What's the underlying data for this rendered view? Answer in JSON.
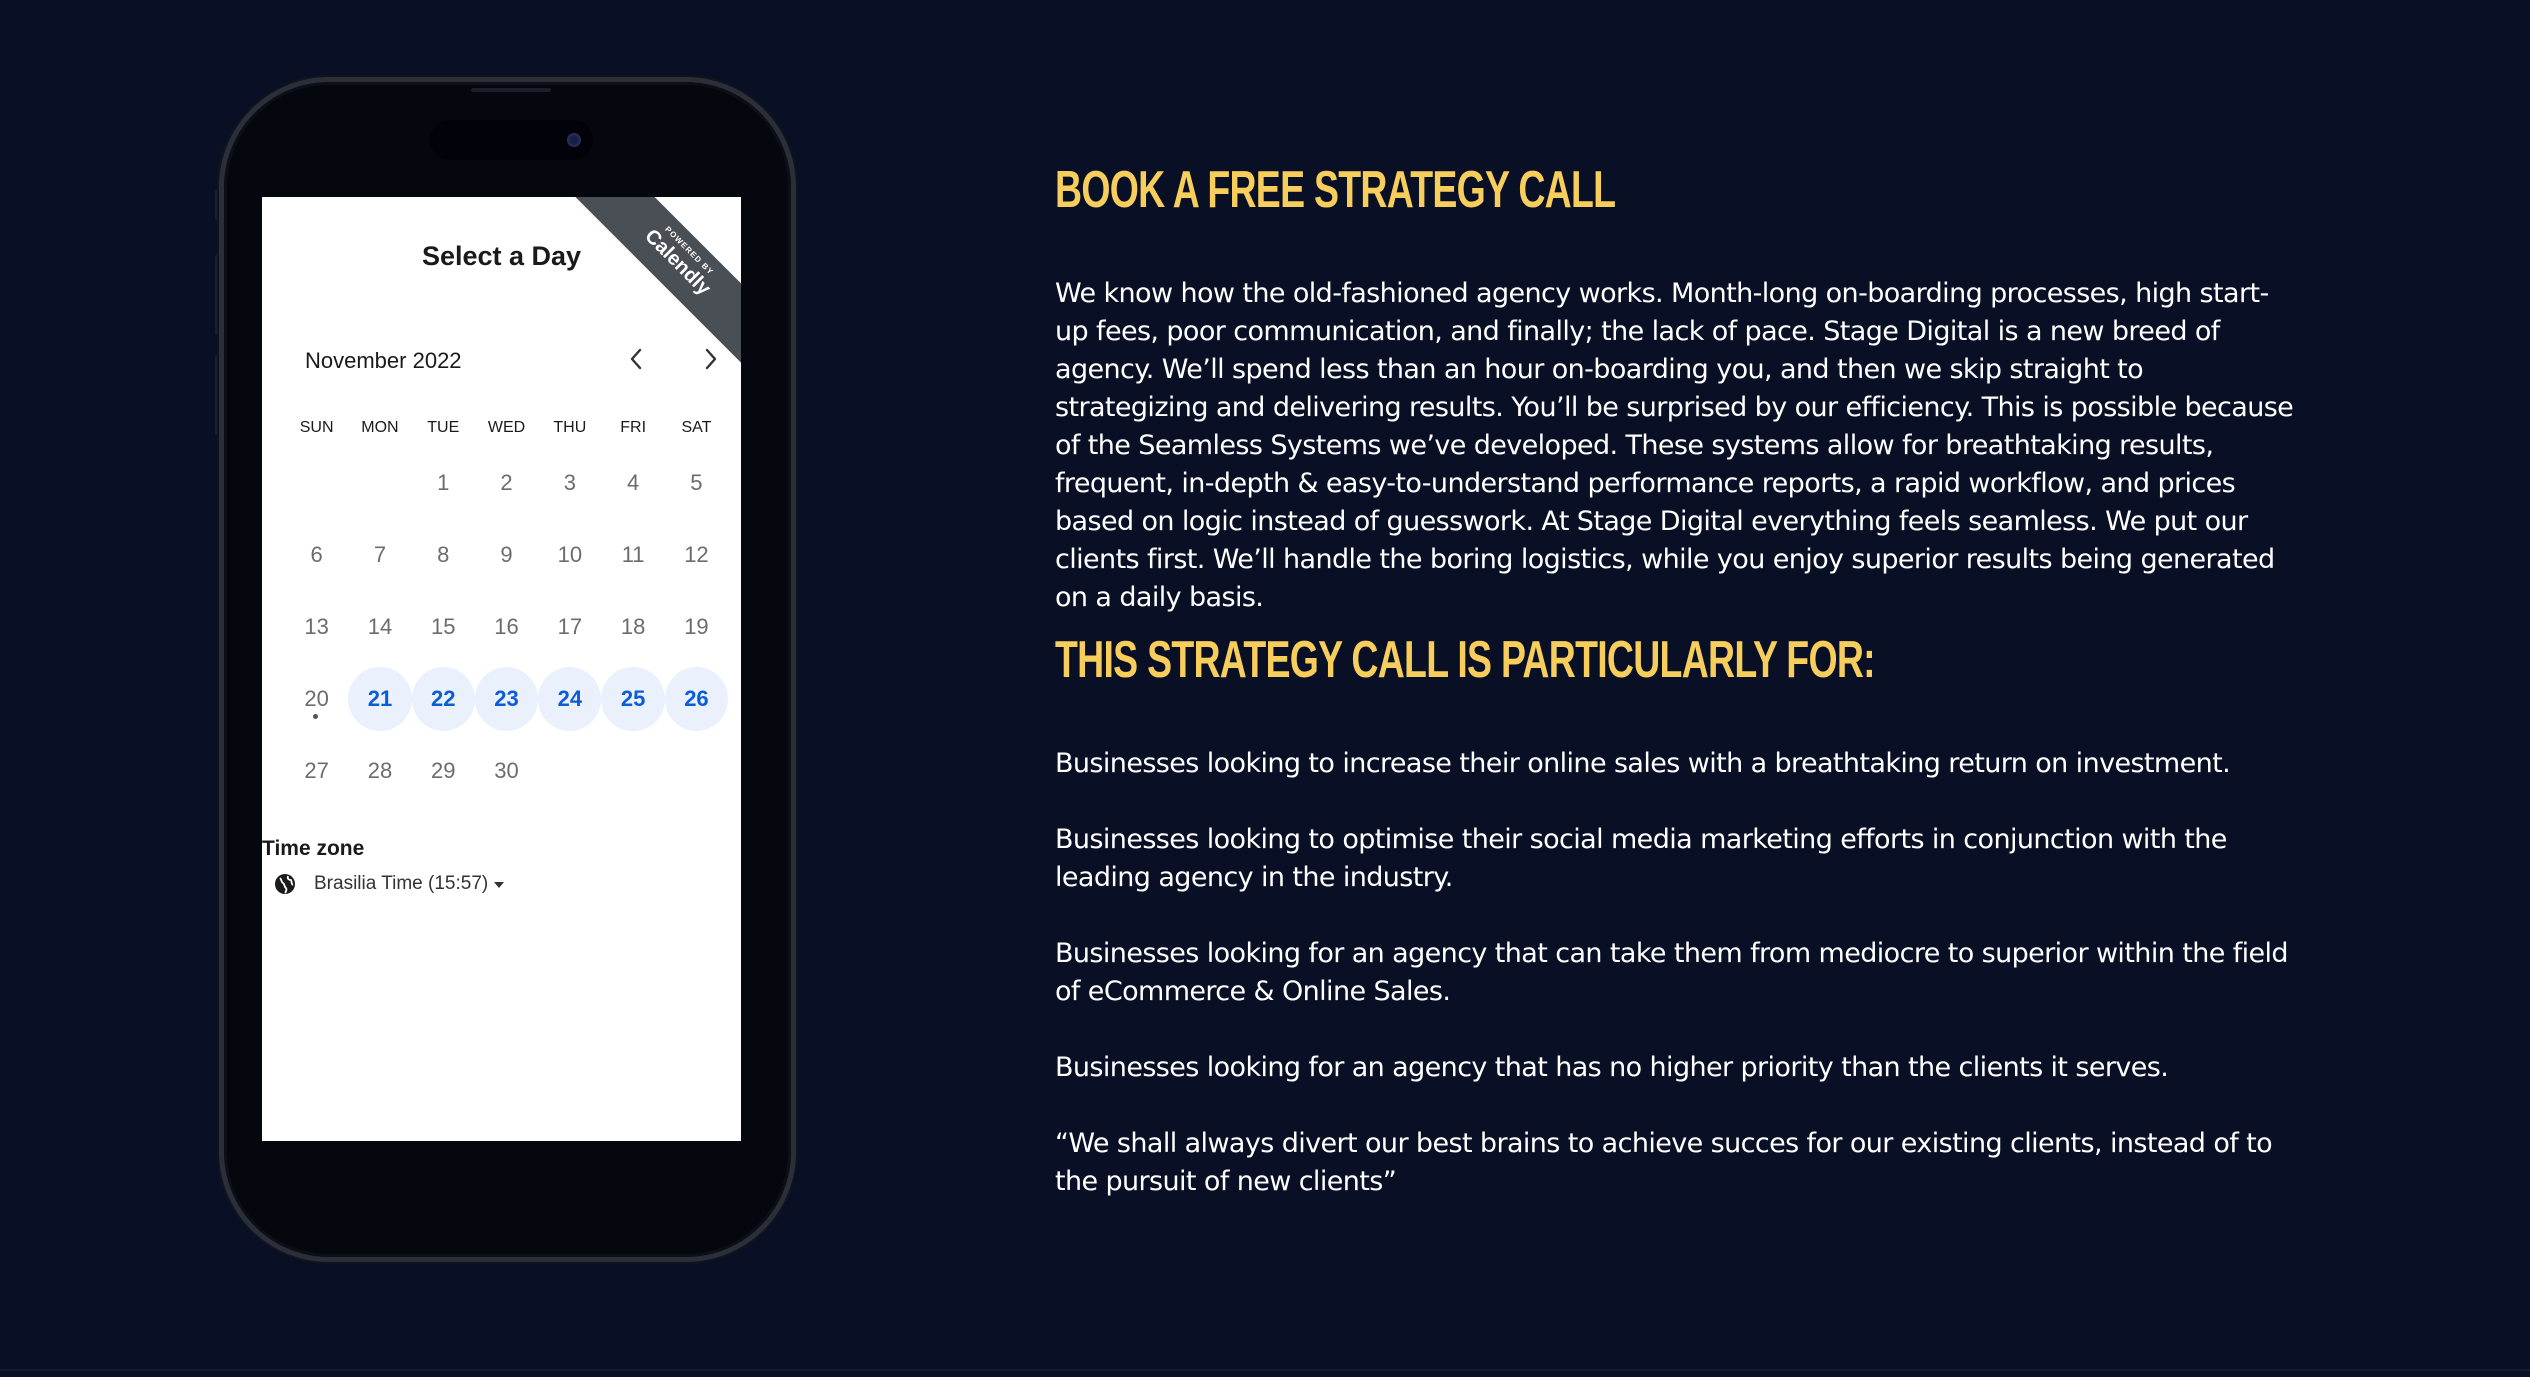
{
  "scheduler": {
    "ribbon": {
      "powered_by": "POWERED BY",
      "brand": "Calendly"
    },
    "title": "Select a Day",
    "month": "November 2022",
    "prev_icon": "chevron-left-icon",
    "next_icon": "chevron-right-icon",
    "weekdays": [
      "SUN",
      "MON",
      "TUE",
      "WED",
      "THU",
      "FRI",
      "SAT"
    ],
    "days": [
      "",
      "",
      "1",
      "2",
      "3",
      "4",
      "5",
      "6",
      "7",
      "8",
      "9",
      "10",
      "11",
      "12",
      "13",
      "14",
      "15",
      "16",
      "17",
      "18",
      "19",
      "20",
      "21",
      "22",
      "23",
      "24",
      "25",
      "26",
      "27",
      "28",
      "29",
      "30",
      "",
      "",
      ""
    ],
    "available_days": [
      "21",
      "22",
      "23",
      "24",
      "25",
      "26"
    ],
    "today": "20",
    "timezone_label": "Time zone",
    "timezone_value": "Brasilia Time (15:57)",
    "timezone_icon": "globe-icon",
    "accent_color": "#0b5cd6"
  },
  "content": {
    "heading1": "BOOK A FREE STRATEGY CALL",
    "intro": "We know how the old-fashioned agency works. Month-long on-boarding processes, high start-up fees, poor communication, and finally; the lack of pace. Stage Digital is a new breed of agency. We’ll spend less than an hour on-boarding you, and then we skip straight to strategizing and delivering results. You’ll be surprised by our efficiency. This is possible because of the Seamless Systems we’ve developed. These systems allow for breathtaking results, frequent, in-depth & easy-to-understand performance reports, a rapid workflow, and prices based on logic instead of guesswork. At Stage Digital everything feels seamless. We put our clients first. We’ll handle the boring logistics, while you enjoy superior results being generated on a daily basis.",
    "heading2": "THIS STRATEGY CALL IS PARTICULARLY FOR:",
    "bullets": [
      "Businesses looking to increase their online sales with a breathtaking return on investment.",
      "Businesses looking to optimise their social media marketing efforts in conjunction with the leading agency in the industry.",
      "Businesses looking for an agency that can take them from mediocre to superior within the field of eCommerce & Online Sales.",
      "Businesses looking for an agency that has no higher priority than the clients it serves.",
      "“We shall always divert our best brains to achieve succes for our existing clients, instead of to the pursuit of new clients”"
    ],
    "heading_color": "#f7cd5b",
    "background_color": "#091025"
  }
}
